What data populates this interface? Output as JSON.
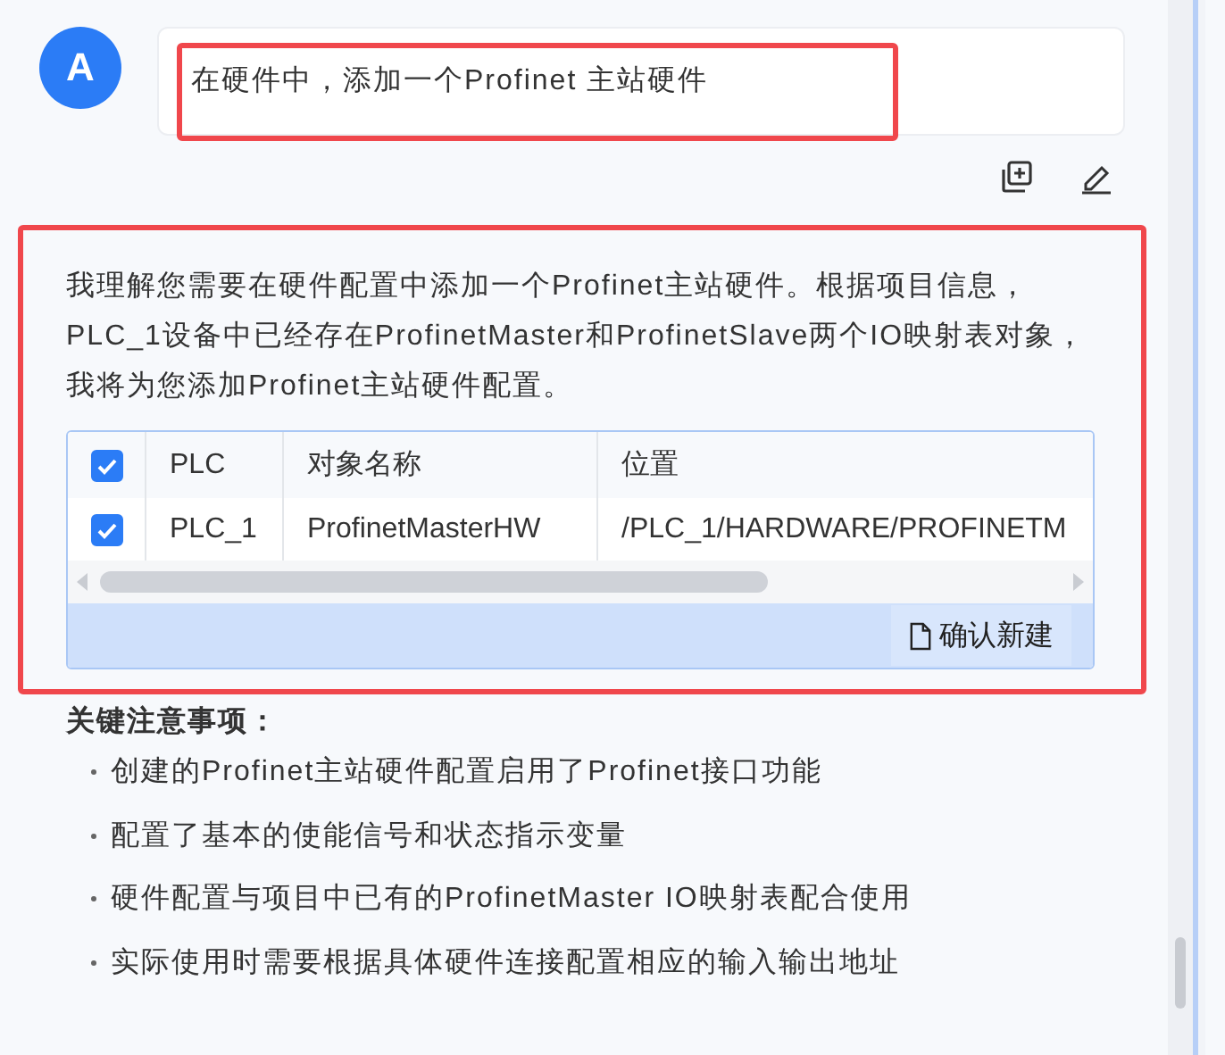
{
  "user_message": {
    "avatar": "A",
    "text": "在硬件中，添加一个Profinet 主站硬件"
  },
  "response": {
    "text": "我理解您需要在硬件配置中添加一个Profinet主站硬件。根据项目信息，PLC_1设备中已经存在ProfinetMaster和ProfinetSlave两个IO映射表对象，我将为您添加Profinet主站硬件配置。",
    "table": {
      "all_checked": true,
      "columns": [
        "PLC",
        "对象名称",
        "位置"
      ],
      "rows": [
        {
          "checked": true,
          "cells": [
            "PLC_1",
            "ProfinetMasterHW",
            "/PLC_1/HARDWARE/PROFINETM"
          ]
        }
      ],
      "confirm_button": "确认新建"
    }
  },
  "notes": {
    "title": "关键注意事项：",
    "items": [
      "创建的Profinet主站硬件配置启用了Profinet接口功能",
      "配置了基本的使能信号和状态指示变量",
      "硬件配置与项目中已有的ProfinetMaster IO映射表配合使用",
      "实际使用时需要根据具体硬件连接配置相应的输入输出地址"
    ]
  }
}
